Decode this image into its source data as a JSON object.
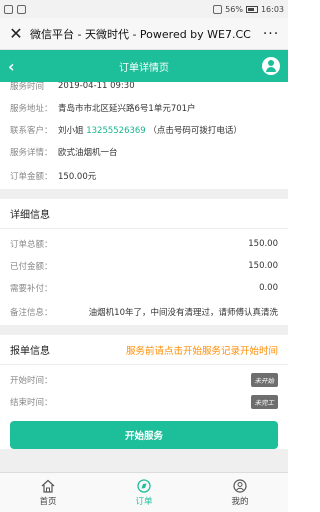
{
  "statusbar": {
    "battery": "56%",
    "time": "16:03"
  },
  "wechat": {
    "title": "微信平台 - 天微时代 - Powered by WE7.CC",
    "close_icon": "close-icon",
    "more_icon": "more-icon"
  },
  "header": {
    "title": "订单详情页",
    "back_icon": "back-icon",
    "user_icon": "user-icon"
  },
  "order_info": {
    "time_label": "服务时间",
    "time_value": "2019-04-11 09:30",
    "address_label": "服务地址：",
    "address_value": "青岛市市北区延兴路6号1单元701户",
    "contact_label": "联系客户：",
    "contact_name": "刘小姐",
    "contact_phone": "13255526369",
    "contact_hint": "（点击号码可拨打电话）",
    "detail_label": "服务详情：",
    "detail_value": "欧式油烟机一台",
    "amount_label": "订单金额：",
    "amount_value": "150.00元"
  },
  "details": {
    "title": "详细信息",
    "rows": [
      {
        "label": "订单总额：",
        "value": "150.00"
      },
      {
        "label": "已付金额：",
        "value": "150.00"
      },
      {
        "label": "需要补付：",
        "value": "0.00"
      }
    ],
    "note_label": "备注信息：",
    "note_value": "油烟机10年了，中间没有清理过，请师傅认真清洗"
  },
  "report": {
    "title": "报单信息",
    "tip": "服务前请点击开始服务记录开始时间",
    "start_label": "开始时间：",
    "start_badge": "未开始",
    "end_label": "结束时间：",
    "end_badge": "未完工",
    "button": "开始服务"
  },
  "tabs": [
    {
      "label": "首页",
      "icon": "home-icon"
    },
    {
      "label": "订单",
      "icon": "order-compass-icon"
    },
    {
      "label": "我的",
      "icon": "profile-icon"
    }
  ],
  "colors": {
    "accent": "#1cbf9a",
    "orange": "#ff8c00"
  }
}
